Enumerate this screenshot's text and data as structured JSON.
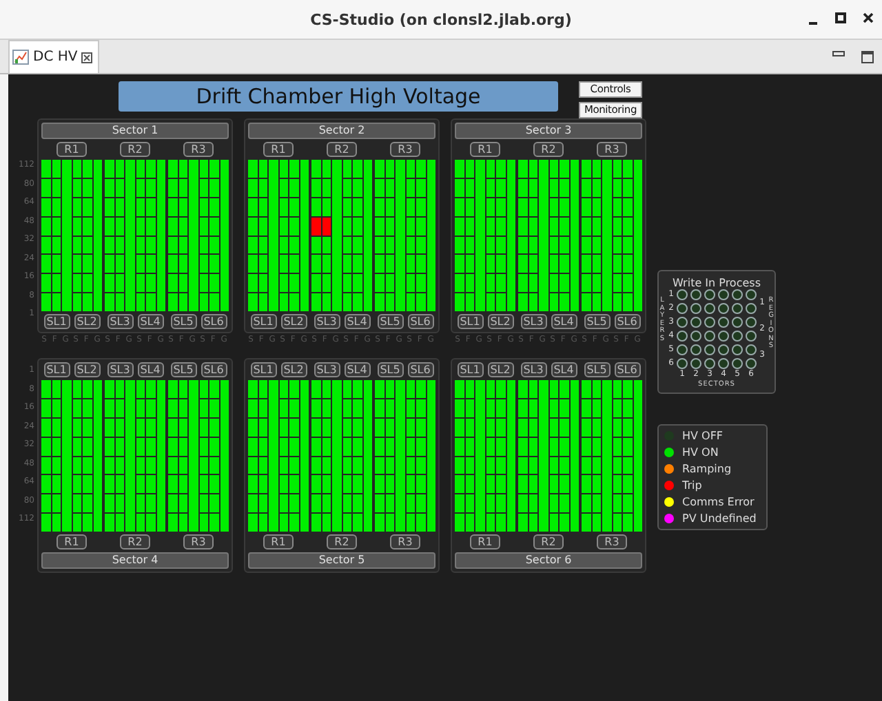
{
  "window": {
    "title": "CS-Studio  (on clonsl2.jlab.org)"
  },
  "tab": {
    "label": "DC HV",
    "selected": true
  },
  "title": "Drift Chamber High Voltage",
  "buttons": [
    "Controls",
    "Monitoring"
  ],
  "sectors": [
    {
      "name": "Sector 1",
      "kind": "top",
      "row_labels": [
        "112",
        "80",
        "64",
        "48",
        "32",
        "24",
        "16",
        "8",
        "1"
      ],
      "regions": [
        "R1",
        "R2",
        "R3"
      ],
      "superlayers": [
        {
          "label": "SL1",
          "legend": "S F G",
          "s_trip": [
            false,
            false,
            false,
            false,
            false,
            false,
            false,
            false
          ],
          "f_trip": [
            false,
            false,
            false,
            false,
            false,
            false,
            false,
            false
          ],
          "g_trip": false
        },
        {
          "label": "SL2",
          "legend": "S F G",
          "s_trip": [
            false,
            false,
            false,
            false,
            false,
            false,
            false,
            false
          ],
          "f_trip": [
            false,
            false,
            false,
            false,
            false,
            false,
            false,
            false
          ],
          "g_trip": false
        },
        {
          "label": "SL3",
          "legend": "S F G",
          "s_trip": [
            false,
            false,
            false,
            false,
            false,
            false,
            false,
            false
          ],
          "f_trip": [
            false,
            false,
            false,
            false,
            false,
            false,
            false,
            false
          ],
          "g_trip": false
        },
        {
          "label": "SL4",
          "legend": "S F G",
          "s_trip": [
            false,
            false,
            false,
            false,
            false,
            false,
            false,
            false
          ],
          "f_trip": [
            false,
            false,
            false,
            false,
            false,
            false,
            false,
            false
          ],
          "g_trip": false
        },
        {
          "label": "SL5",
          "legend": "S F G",
          "s_trip": [
            false,
            false,
            false,
            false,
            false,
            false,
            false,
            false
          ],
          "f_trip": [
            false,
            false,
            false,
            false,
            false,
            false,
            false,
            false
          ],
          "g_trip": false
        },
        {
          "label": "SL6",
          "legend": "S F G",
          "s_trip": [
            false,
            false,
            false,
            false,
            false,
            false,
            false,
            false
          ],
          "f_trip": [
            false,
            false,
            false,
            false,
            false,
            false,
            false,
            false
          ],
          "g_trip": false
        }
      ]
    },
    {
      "name": "Sector 2",
      "kind": "top",
      "regions": [
        "R1",
        "R2",
        "R3"
      ],
      "superlayers": [
        {
          "label": "SL1",
          "legend": "S F G",
          "s_trip": [
            false,
            false,
            false,
            false,
            false,
            false,
            false,
            false
          ],
          "f_trip": [
            false,
            false,
            false,
            false,
            false,
            false,
            false,
            false
          ],
          "g_trip": false
        },
        {
          "label": "SL2",
          "legend": "S F G",
          "s_trip": [
            false,
            false,
            false,
            false,
            false,
            false,
            false,
            false
          ],
          "f_trip": [
            false,
            false,
            false,
            false,
            false,
            false,
            false,
            false
          ],
          "g_trip": false
        },
        {
          "label": "SL3",
          "legend": "S F G",
          "s_trip": [
            false,
            false,
            false,
            true,
            false,
            false,
            false,
            false
          ],
          "f_trip": [
            false,
            false,
            false,
            true,
            false,
            false,
            false,
            false
          ],
          "g_trip": false
        },
        {
          "label": "SL4",
          "legend": "S F G",
          "s_trip": [
            false,
            false,
            false,
            false,
            false,
            false,
            false,
            false
          ],
          "f_trip": [
            false,
            false,
            false,
            false,
            false,
            false,
            false,
            false
          ],
          "g_trip": false
        },
        {
          "label": "SL5",
          "legend": "S F G",
          "s_trip": [
            false,
            false,
            false,
            false,
            false,
            false,
            false,
            false
          ],
          "f_trip": [
            false,
            false,
            false,
            false,
            false,
            false,
            false,
            false
          ],
          "g_trip": false
        },
        {
          "label": "SL6",
          "legend": "S F G",
          "s_trip": [
            false,
            false,
            false,
            false,
            false,
            false,
            false,
            false
          ],
          "f_trip": [
            false,
            false,
            false,
            false,
            false,
            false,
            false,
            false
          ],
          "g_trip": false
        }
      ]
    },
    {
      "name": "Sector 3",
      "kind": "top",
      "regions": [
        "R1",
        "R2",
        "R3"
      ],
      "superlayers": [
        {
          "label": "SL1",
          "legend": "S F G",
          "s_trip": [
            false,
            false,
            false,
            false,
            false,
            false,
            false,
            false
          ],
          "f_trip": [
            false,
            false,
            false,
            false,
            false,
            false,
            false,
            false
          ],
          "g_trip": false
        },
        {
          "label": "SL2",
          "legend": "S F G",
          "s_trip": [
            false,
            false,
            false,
            false,
            false,
            false,
            false,
            false
          ],
          "f_trip": [
            false,
            false,
            false,
            false,
            false,
            false,
            false,
            false
          ],
          "g_trip": false
        },
        {
          "label": "SL3",
          "legend": "S F G",
          "s_trip": [
            false,
            false,
            false,
            false,
            false,
            false,
            false,
            false
          ],
          "f_trip": [
            false,
            false,
            false,
            false,
            false,
            false,
            false,
            false
          ],
          "g_trip": false
        },
        {
          "label": "SL4",
          "legend": "S F G",
          "s_trip": [
            false,
            false,
            false,
            false,
            false,
            false,
            false,
            false
          ],
          "f_trip": [
            false,
            false,
            false,
            false,
            false,
            false,
            false,
            false
          ],
          "g_trip": false
        },
        {
          "label": "SL5",
          "legend": "S F G",
          "s_trip": [
            false,
            false,
            false,
            false,
            false,
            false,
            false,
            false
          ],
          "f_trip": [
            false,
            false,
            false,
            false,
            false,
            false,
            false,
            false
          ],
          "g_trip": false
        },
        {
          "label": "SL6",
          "legend": "S F G",
          "s_trip": [
            false,
            false,
            false,
            false,
            false,
            false,
            false,
            false
          ],
          "f_trip": [
            false,
            false,
            false,
            false,
            false,
            false,
            false,
            false
          ],
          "g_trip": false
        }
      ]
    },
    {
      "name": "Sector 4",
      "kind": "bottom",
      "row_labels": [
        "1",
        "8",
        "16",
        "24",
        "32",
        "48",
        "64",
        "80",
        "112"
      ],
      "regions": [
        "R1",
        "R2",
        "R3"
      ],
      "superlayers": [
        {
          "label": "SL1",
          "s_trip": [
            false,
            false,
            false,
            false,
            false,
            false,
            false,
            false
          ],
          "f_trip": [
            false,
            false,
            false,
            false,
            false,
            false,
            false,
            false
          ],
          "g_trip": false
        },
        {
          "label": "SL2",
          "s_trip": [
            false,
            false,
            false,
            false,
            false,
            false,
            false,
            false
          ],
          "f_trip": [
            false,
            false,
            false,
            false,
            false,
            false,
            false,
            false
          ],
          "g_trip": false
        },
        {
          "label": "SL3",
          "s_trip": [
            false,
            false,
            false,
            false,
            false,
            false,
            false,
            false
          ],
          "f_trip": [
            false,
            false,
            false,
            false,
            false,
            false,
            false,
            false
          ],
          "g_trip": false
        },
        {
          "label": "SL4",
          "s_trip": [
            false,
            false,
            false,
            false,
            false,
            false,
            false,
            false
          ],
          "f_trip": [
            false,
            false,
            false,
            false,
            false,
            false,
            false,
            false
          ],
          "g_trip": false
        },
        {
          "label": "SL5",
          "s_trip": [
            false,
            false,
            false,
            false,
            false,
            false,
            false,
            false
          ],
          "f_trip": [
            false,
            false,
            false,
            false,
            false,
            false,
            false,
            false
          ],
          "g_trip": false
        },
        {
          "label": "SL6",
          "s_trip": [
            false,
            false,
            false,
            false,
            false,
            false,
            false,
            false
          ],
          "f_trip": [
            false,
            false,
            false,
            false,
            false,
            false,
            false,
            false
          ],
          "g_trip": false
        }
      ]
    },
    {
      "name": "Sector 5",
      "kind": "bottom",
      "regions": [
        "R1",
        "R2",
        "R3"
      ],
      "superlayers": [
        {
          "label": "SL1",
          "s_trip": [
            false,
            false,
            false,
            false,
            false,
            false,
            false,
            false
          ],
          "f_trip": [
            false,
            false,
            false,
            false,
            false,
            false,
            false,
            false
          ],
          "g_trip": false
        },
        {
          "label": "SL2",
          "s_trip": [
            false,
            false,
            false,
            false,
            false,
            false,
            false,
            false
          ],
          "f_trip": [
            false,
            false,
            false,
            false,
            false,
            false,
            false,
            false
          ],
          "g_trip": false
        },
        {
          "label": "SL3",
          "s_trip": [
            false,
            false,
            false,
            false,
            false,
            false,
            false,
            false
          ],
          "f_trip": [
            false,
            false,
            false,
            false,
            false,
            false,
            false,
            false
          ],
          "g_trip": false
        },
        {
          "label": "SL4",
          "s_trip": [
            false,
            false,
            false,
            false,
            false,
            false,
            false,
            false
          ],
          "f_trip": [
            false,
            false,
            false,
            false,
            false,
            false,
            false,
            false
          ],
          "g_trip": false
        },
        {
          "label": "SL5",
          "s_trip": [
            false,
            false,
            false,
            false,
            false,
            false,
            false,
            false
          ],
          "f_trip": [
            false,
            false,
            false,
            false,
            false,
            false,
            false,
            false
          ],
          "g_trip": false
        },
        {
          "label": "SL6",
          "s_trip": [
            false,
            false,
            false,
            false,
            false,
            false,
            false,
            false
          ],
          "f_trip": [
            false,
            false,
            false,
            false,
            false,
            false,
            false,
            false
          ],
          "g_trip": false
        }
      ]
    },
    {
      "name": "Sector 6",
      "kind": "bottom",
      "regions": [
        "R1",
        "R2",
        "R3"
      ],
      "superlayers": [
        {
          "label": "SL1",
          "s_trip": [
            false,
            false,
            false,
            false,
            false,
            false,
            false,
            false
          ],
          "f_trip": [
            false,
            false,
            false,
            false,
            false,
            false,
            false,
            false
          ],
          "g_trip": false
        },
        {
          "label": "SL2",
          "s_trip": [
            false,
            false,
            false,
            false,
            false,
            false,
            false,
            false
          ],
          "f_trip": [
            false,
            false,
            false,
            false,
            false,
            false,
            false,
            false
          ],
          "g_trip": false
        },
        {
          "label": "SL3",
          "s_trip": [
            false,
            false,
            false,
            false,
            false,
            false,
            false,
            false
          ],
          "f_trip": [
            false,
            false,
            false,
            false,
            false,
            false,
            false,
            false
          ],
          "g_trip": false
        },
        {
          "label": "SL4",
          "s_trip": [
            false,
            false,
            false,
            false,
            false,
            false,
            false,
            false
          ],
          "f_trip": [
            false,
            false,
            false,
            false,
            false,
            false,
            false,
            false
          ],
          "g_trip": false
        },
        {
          "label": "SL5",
          "s_trip": [
            false,
            false,
            false,
            false,
            false,
            false,
            false,
            false
          ],
          "f_trip": [
            false,
            false,
            false,
            false,
            false,
            false,
            false,
            false
          ],
          "g_trip": false
        },
        {
          "label": "SL6",
          "s_trip": [
            false,
            false,
            false,
            false,
            false,
            false,
            false,
            false
          ],
          "f_trip": [
            false,
            false,
            false,
            false,
            false,
            false,
            false,
            false
          ],
          "g_trip": false
        }
      ]
    }
  ],
  "write_in": {
    "title": "Write In Process",
    "layers_axis": "LAYERS",
    "regions_axis": "REGIONS",
    "sectors_axis": "SECTORS",
    "regions": [
      "1",
      "2",
      "3"
    ],
    "sectors": [
      "1",
      "2",
      "3",
      "4",
      "5",
      "6"
    ],
    "layers": [
      {
        "label": "1",
        "active": [
          false,
          false,
          false,
          false,
          false,
          false
        ]
      },
      {
        "label": "2",
        "active": [
          false,
          false,
          false,
          false,
          false,
          false
        ]
      },
      {
        "label": "3",
        "active": [
          false,
          false,
          false,
          false,
          false,
          false
        ]
      },
      {
        "label": "4",
        "active": [
          false,
          false,
          false,
          false,
          false,
          false
        ]
      },
      {
        "label": "5",
        "active": [
          false,
          false,
          false,
          false,
          false,
          false
        ]
      },
      {
        "label": "6",
        "active": [
          false,
          false,
          false,
          false,
          false,
          false
        ]
      }
    ]
  },
  "legend": [
    {
      "label": "HV OFF",
      "color": "#1f3a1f"
    },
    {
      "label": "HV ON",
      "color": "#00e000"
    },
    {
      "label": "Ramping",
      "color": "#ff7f00"
    },
    {
      "label": "Trip",
      "color": "#ff0000"
    },
    {
      "label": "Comms Error",
      "color": "#ffff00"
    },
    {
      "label": "PV Undefined",
      "color": "#ff00ff"
    }
  ]
}
